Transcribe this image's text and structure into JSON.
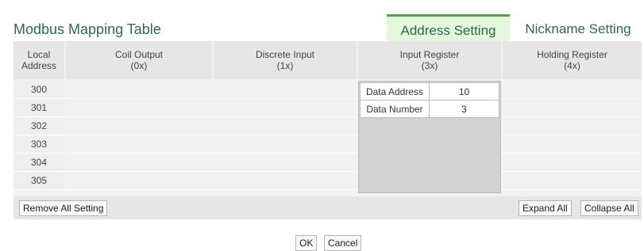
{
  "title": "Modbus Mapping Table",
  "tabs": [
    {
      "label": "Address Setting",
      "active": true
    },
    {
      "label": "Nickname Setting",
      "active": false
    }
  ],
  "columns": {
    "local": [
      "Local",
      "Address"
    ],
    "coil": [
      "Coil Output",
      "(0x)"
    ],
    "discrete": [
      "Discrete Input",
      "(1x)"
    ],
    "input": [
      "Input Register",
      "(3x)"
    ],
    "holding": [
      "Holding Register",
      "(4x)"
    ]
  },
  "addresses": [
    "300",
    "301",
    "302",
    "303",
    "304",
    "305"
  ],
  "input_register": {
    "data_address_label": "Data Address",
    "data_address_value": "10",
    "data_number_label": "Data Number",
    "data_number_value": "3"
  },
  "buttons": {
    "remove_all": "Remove All Setting",
    "expand_all": "Expand All",
    "collapse_all": "Collapse All",
    "ok": "OK",
    "cancel": "Cancel"
  },
  "colors": {
    "accent": "#4fa443",
    "title": "#2e6b44",
    "active_tab_bg": "#e4f6dc"
  }
}
